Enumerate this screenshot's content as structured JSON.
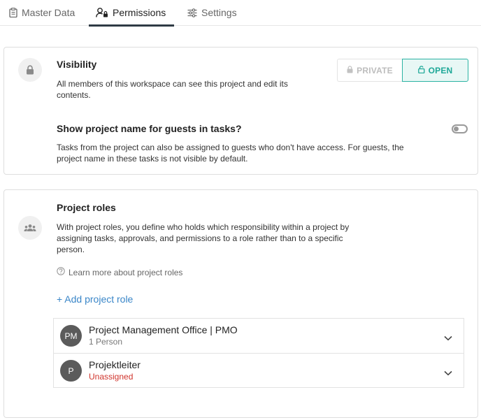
{
  "tabs": [
    {
      "label": "Master Data",
      "icon": "clipboard-icon",
      "active": false
    },
    {
      "label": "Permissions",
      "icon": "user-lock-icon",
      "active": true
    },
    {
      "label": "Settings",
      "icon": "sliders-icon",
      "active": false
    }
  ],
  "visibility": {
    "title": "Visibility",
    "description": "All members of this workspace can see this project and edit its contents.",
    "icon": "lock-icon",
    "options": {
      "private_label": "PRIVATE",
      "open_label": "OPEN",
      "selected": "open"
    }
  },
  "guests": {
    "title": "Show project name for guests in tasks?",
    "description": "Tasks from the project can also be assigned to guests who don't have access. For guests, the project name in these tasks is not visible by default.",
    "toggle_on": false
  },
  "project_roles": {
    "title": "Project roles",
    "icon": "group-icon",
    "description": "With project roles, you define who holds which responsibility within a project by assigning tasks, approvals, and permissions to a role rather than to a specific person.",
    "learn_more": "Learn more about project roles",
    "add_role": "+ Add project role",
    "roles": [
      {
        "initials": "PM",
        "name": "Project Management Office | PMO",
        "sub": "1 Person",
        "status": "assigned"
      },
      {
        "initials": "P",
        "name": "Projektleiter",
        "sub": "Unassigned",
        "status": "unassigned"
      }
    ]
  },
  "colors": {
    "accent": "#1ea898",
    "link": "#3a86c8",
    "warning": "#d0342c"
  }
}
